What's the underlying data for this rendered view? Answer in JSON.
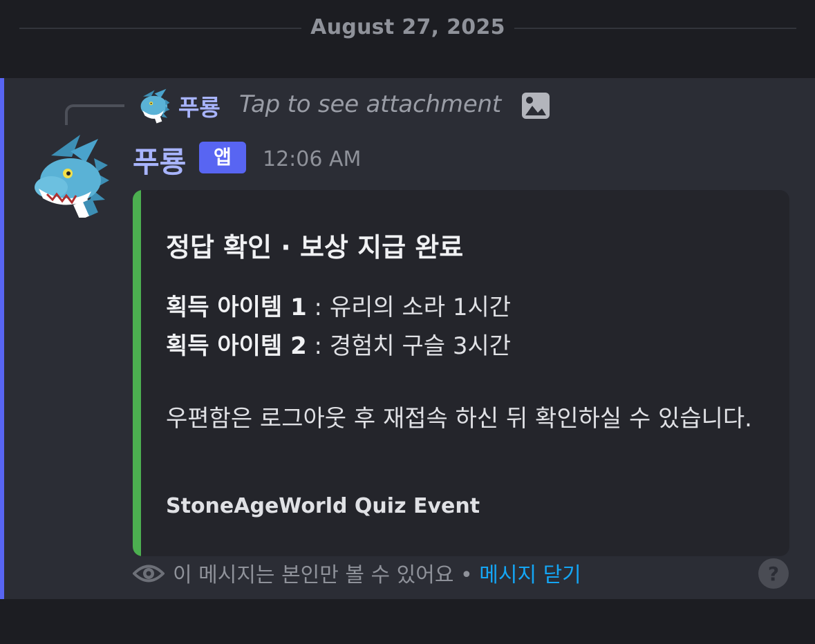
{
  "date_divider": {
    "label": "August 27, 2025"
  },
  "reply": {
    "author": "푸룡",
    "text": "Tap to see attachment",
    "image_icon": "image-icon"
  },
  "message": {
    "author": "푸룡",
    "badge": "앱",
    "timestamp": "12:06 AM",
    "avatar_icon": "blue-dragon-avatar"
  },
  "embed": {
    "accent_color": "#4caf50",
    "title": "정답 확인 · 보상 지급 완료",
    "items": [
      {
        "label": "획득 아이템 1",
        "separator": " : ",
        "value": "유리의 소라 1시간"
      },
      {
        "label": "획득 아이템 2",
        "separator": " : ",
        "value": "경험치 구슬 3시간"
      }
    ],
    "description": "우편함은 로그아웃 후 재접속 하신 뒤 확인하실 수 있습니다.",
    "footer": "StoneAgeWorld Quiz Event"
  },
  "notice": {
    "text": "이 메시지는 본인만 볼 수 있어요 • ",
    "dismiss_label": "메시지 닫기",
    "eye_icon": "eye-icon",
    "help_icon": "help-icon"
  },
  "colors": {
    "background": "#1c1d22",
    "highlight": "#2b2d35",
    "mention_bar": "#5865f2",
    "author": "#a8b4ff",
    "link": "#14a6f5"
  }
}
